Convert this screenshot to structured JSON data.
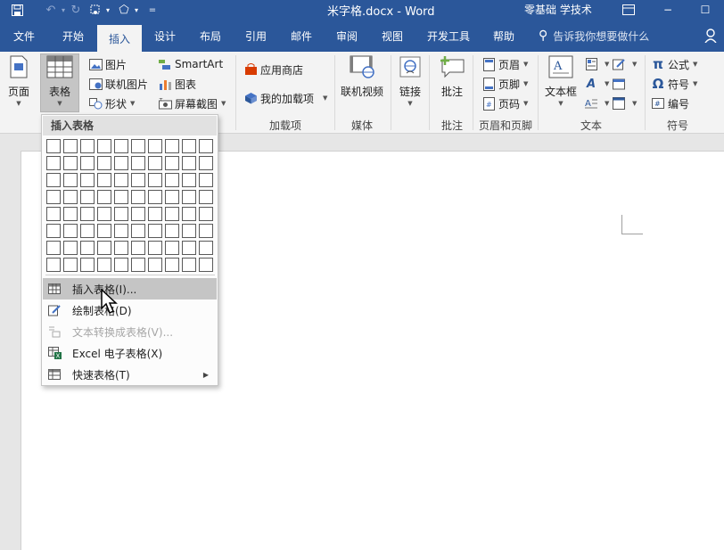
{
  "titlebar": {
    "doc_title": "米字格.docx  -  Word",
    "account": "零基础 学技术",
    "minimize": "−",
    "maximize": "☐"
  },
  "qat": {
    "save_icon": "save-icon",
    "undo_icon": "undo-icon",
    "redo_icon": "redo-icon",
    "customize": "="
  },
  "tabs": [
    {
      "label": "文件"
    },
    {
      "label": "开始"
    },
    {
      "label": "插入"
    },
    {
      "label": "设计"
    },
    {
      "label": "布局"
    },
    {
      "label": "引用"
    },
    {
      "label": "邮件"
    },
    {
      "label": "审阅"
    },
    {
      "label": "视图"
    },
    {
      "label": "开发工具"
    },
    {
      "label": "帮助"
    }
  ],
  "tellme": "告诉我你想要做什么",
  "ribbon": {
    "page_btn": "页面",
    "table_btn": "表格",
    "picture": "图片",
    "online_picture": "联机图片",
    "shapes": "形状",
    "smartart": "SmartArt",
    "chart": "图表",
    "screenshot": "屏幕截图",
    "app_store": "应用商店",
    "my_addins": "我的加载项",
    "addins_group": "加载项",
    "online_video": "联机视频",
    "media_group": "媒体",
    "link": "链接",
    "comment": "批注",
    "comment_group": "批注",
    "header": "页眉",
    "footer": "页脚",
    "page_number": "页码",
    "header_footer_group": "页眉和页脚",
    "textbox": "文本框",
    "text_group": "文本",
    "equation": "公式",
    "symbol": "符号",
    "number": "编号",
    "symbols_group": "符号",
    "pi": "π",
    "omega": "Ω"
  },
  "dropdown": {
    "header": "插入表格",
    "grid_cols": 10,
    "grid_rows": 8,
    "items": [
      {
        "label": "插入表格(I)...",
        "highlighted": true,
        "disabled": false
      },
      {
        "label": "绘制表格(D)",
        "highlighted": false,
        "disabled": false
      },
      {
        "label": "文本转换成表格(V)...",
        "highlighted": false,
        "disabled": true
      },
      {
        "label": "Excel 电子表格(X)",
        "highlighted": false,
        "disabled": false
      },
      {
        "label": "快速表格(T)",
        "highlighted": false,
        "disabled": false
      }
    ]
  },
  "colors": {
    "brand": "#2b579a",
    "ribbon": "#f3f3f3",
    "highlight": "#c5c5c5"
  }
}
